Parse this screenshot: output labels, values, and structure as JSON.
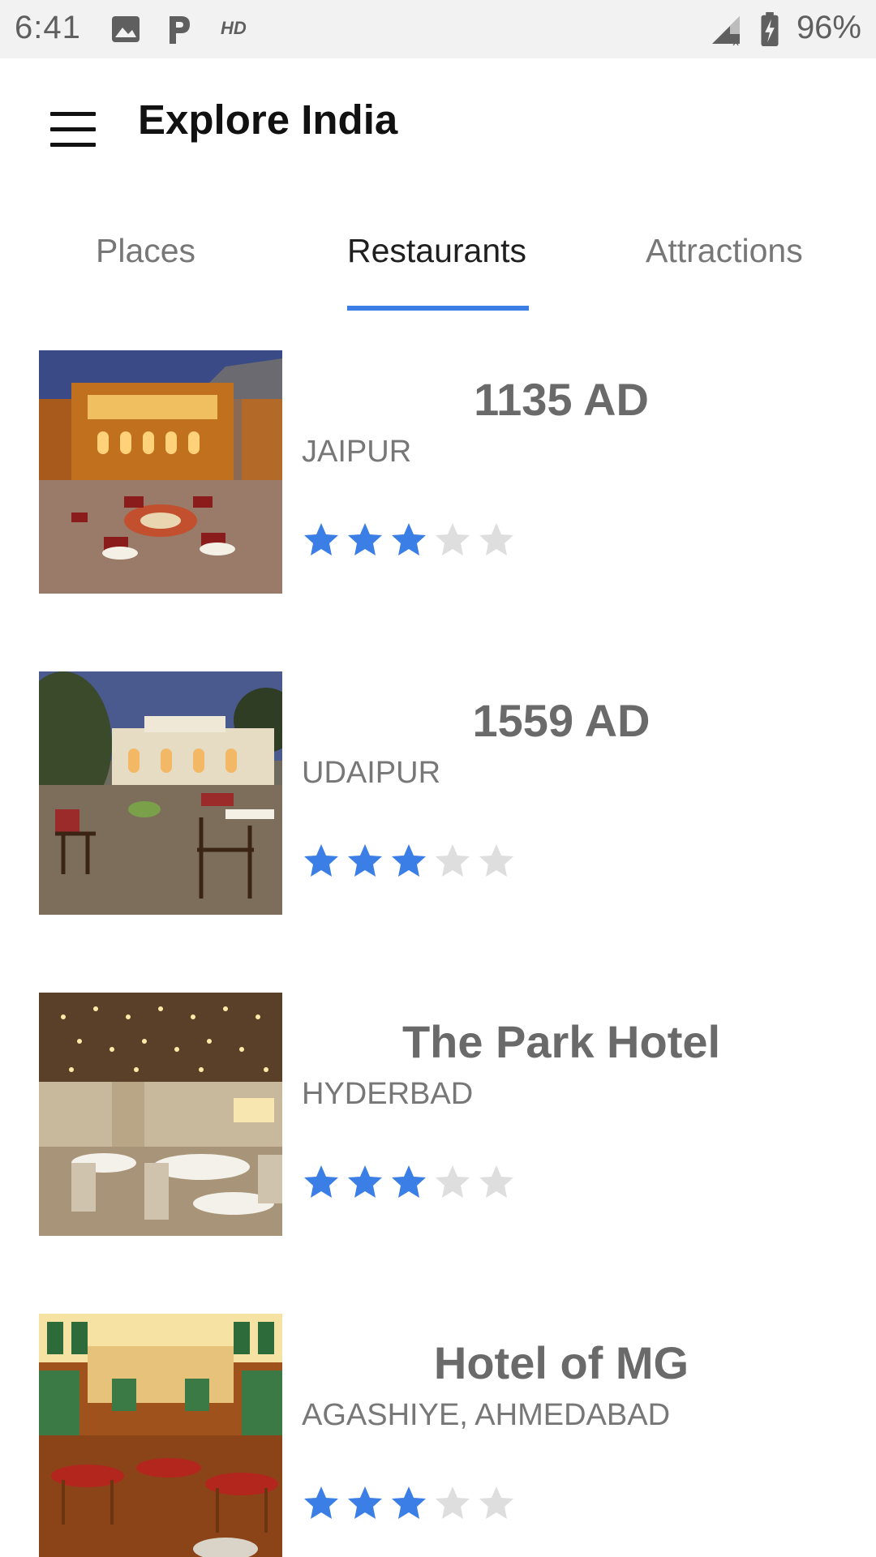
{
  "status_bar": {
    "time": "6:41",
    "icons_left": [
      "image-icon",
      "parking-icon",
      "hd-icon"
    ],
    "icons_right": [
      "signal-icon",
      "battery-charging-icon"
    ],
    "battery": "96%",
    "hd_label": "HD"
  },
  "app_bar": {
    "title": "Explore India",
    "menu_icon": "menu-icon"
  },
  "tabs": [
    {
      "label": "Places",
      "active": false
    },
    {
      "label": "Restaurants",
      "active": true
    },
    {
      "label": "Attractions",
      "active": false
    }
  ],
  "colors": {
    "accent": "#3b7fe6",
    "star_filled": "#3b7fe6",
    "star_empty": "#dedede",
    "title_text": "#6a6a6a",
    "subtitle_text": "#777777"
  },
  "restaurants": [
    {
      "name": "1135 AD",
      "location": "JAIPUR",
      "rating": 3,
      "max_rating": 5,
      "thumb_icon": "courtyard-restaurant-image"
    },
    {
      "name": "1559 AD",
      "location": "UDAIPUR",
      "rating": 3,
      "max_rating": 5,
      "thumb_icon": "garden-restaurant-image"
    },
    {
      "name": "The Park Hotel",
      "location": "HYDERBAD",
      "rating": 3,
      "max_rating": 5,
      "thumb_icon": "dining-hall-image"
    },
    {
      "name": "Hotel of MG",
      "location": "AGASHIYE, AHMEDABAD",
      "rating": 3,
      "max_rating": 5,
      "thumb_icon": "ornate-dining-image"
    }
  ]
}
